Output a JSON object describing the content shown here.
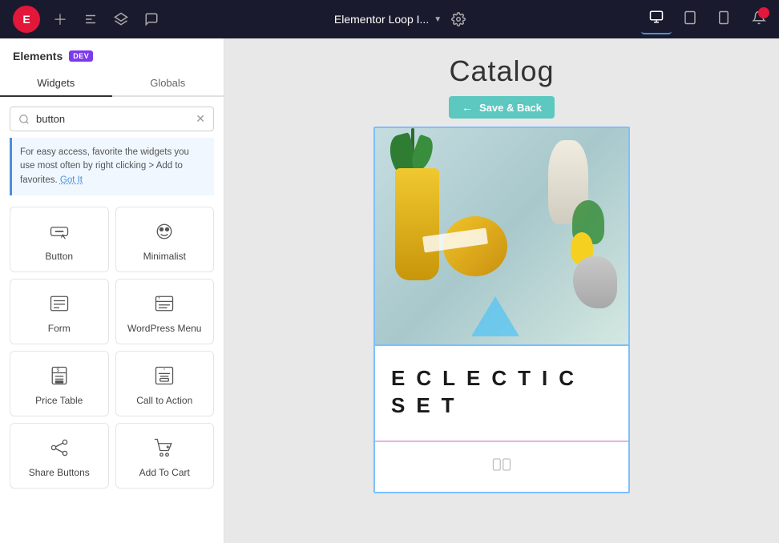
{
  "topbar": {
    "logo_text": "E",
    "app_title": "Elementor Loop I...",
    "add_label": "+",
    "settings_label": "⚙",
    "devices": [
      "desktop",
      "tablet",
      "mobile"
    ],
    "active_device": "desktop"
  },
  "sidebar": {
    "title": "Elements",
    "dev_badge": "DEV",
    "tabs": [
      "Widgets",
      "Globals"
    ],
    "active_tab": "Widgets",
    "search_placeholder": "button",
    "search_value": "button",
    "hint_text": "For easy access, favorite the widgets you use most often by right clicking > Add to favorites.",
    "hint_link": "Got It",
    "widgets": [
      {
        "id": "button",
        "label": "Button"
      },
      {
        "id": "minimalist",
        "label": "Minimalist"
      },
      {
        "id": "form",
        "label": "Form"
      },
      {
        "id": "wordpress-menu",
        "label": "WordPress Menu"
      },
      {
        "id": "price-table",
        "label": "Price Table"
      },
      {
        "id": "call-to-action",
        "label": "Call to Action"
      },
      {
        "id": "share-buttons",
        "label": "Share Buttons"
      },
      {
        "id": "add-to-cart",
        "label": "Add To Cart"
      }
    ]
  },
  "canvas": {
    "title": "Catalog",
    "save_back_label": "Save & Back",
    "eclectic_line1": "ECLECTIC",
    "eclectic_line2": "SET"
  }
}
